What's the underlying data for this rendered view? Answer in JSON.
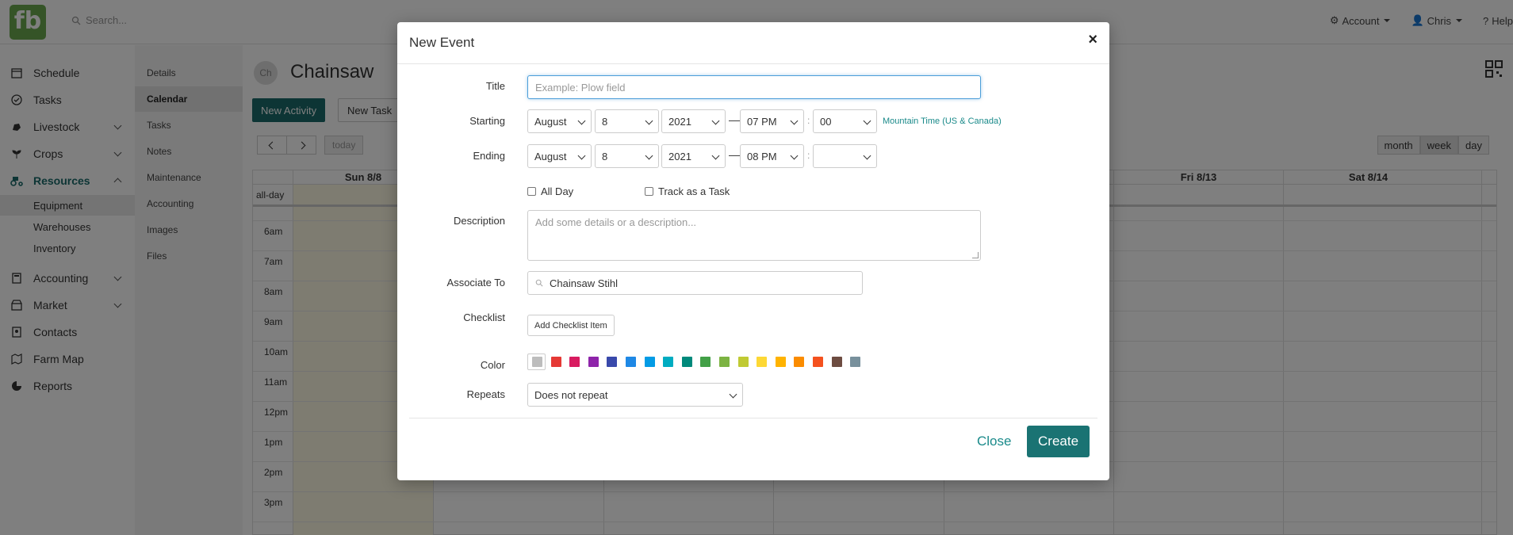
{
  "header": {
    "logo_text": "fb",
    "search_placeholder": "Search...",
    "account_label": "Account",
    "user_label": "Chris",
    "help_label": "Help"
  },
  "sidebar": {
    "items": [
      {
        "label": "Schedule",
        "icon": "calendar-icon"
      },
      {
        "label": "Tasks",
        "icon": "check-circle-icon"
      },
      {
        "label": "Livestock",
        "icon": "livestock-icon"
      },
      {
        "label": "Crops",
        "icon": "sprout-icon"
      },
      {
        "label": "Resources",
        "icon": "tractor-icon"
      },
      {
        "label": "Accounting",
        "icon": "calculator-icon"
      },
      {
        "label": "Market",
        "icon": "store-icon"
      },
      {
        "label": "Contacts",
        "icon": "address-book-icon"
      },
      {
        "label": "Farm Map",
        "icon": "map-icon"
      },
      {
        "label": "Reports",
        "icon": "pie-chart-icon"
      }
    ],
    "resources_sub": [
      "Equipment",
      "Warehouses",
      "Inventory"
    ]
  },
  "subnav": {
    "items": [
      "Details",
      "Calendar",
      "Tasks",
      "Notes",
      "Maintenance",
      "Accounting",
      "Images",
      "Files"
    ],
    "selected": "Calendar"
  },
  "main": {
    "avatar_initials": "Ch",
    "title": "Chainsaw",
    "new_activity_label": "New Activity",
    "new_task_label": "New Task",
    "today_label": "today",
    "views": [
      "month",
      "week",
      "day"
    ],
    "active_view": "week",
    "day_headers": [
      "Sun 8/8",
      "Fri 8/13",
      "Sat 8/14"
    ],
    "allday_label": "all-day",
    "hours": [
      "6am",
      "7am",
      "8am",
      "9am",
      "10am",
      "11am",
      "12pm",
      "1pm",
      "2pm",
      "3pm"
    ]
  },
  "modal": {
    "title": "New Event",
    "close_symbol": "×",
    "labels": {
      "title": "Title",
      "starting": "Starting",
      "ending": "Ending",
      "description": "Description",
      "associate": "Associate To",
      "checklist": "Checklist",
      "color": "Color",
      "repeats": "Repeats"
    },
    "title_placeholder": "Example: Plow field",
    "starting": {
      "month": "August",
      "day": "8",
      "year": "2021",
      "hour": "07 PM",
      "minute": "00"
    },
    "ending": {
      "month": "August",
      "day": "8",
      "year": "2021",
      "hour": "08 PM",
      "minute": ""
    },
    "timezone": "Mountain Time (US & Canada)",
    "all_day_label": "All Day",
    "track_task_label": "Track as a Task",
    "description_placeholder": "Add some details or a description...",
    "associate_value": "Chainsaw Stihl",
    "add_checklist_label": "Add Checklist Item",
    "colors": [
      "#bdbdbd",
      "#e53935",
      "#d81b60",
      "#8e24aa",
      "#3949ab",
      "#1e88e5",
      "#039be5",
      "#00acc1",
      "#00897b",
      "#43a047",
      "#7cb342",
      "#c0ca33",
      "#fdd835",
      "#ffb300",
      "#fb8c00",
      "#f4511e",
      "#6d4c41",
      "#78909c"
    ],
    "repeats_value": "Does not repeat",
    "close_label": "Close",
    "create_label": "Create"
  }
}
